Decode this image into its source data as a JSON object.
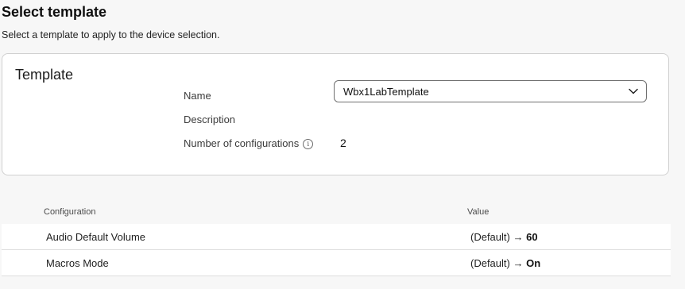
{
  "header": {
    "title": "Select template",
    "subtitle": "Select a template to apply to the device selection."
  },
  "template_card": {
    "title": "Template",
    "name_label": "Name",
    "description_label": "Description",
    "count_label": "Number of configurations",
    "count_info_icon": "info-circle-icon",
    "selected_template": "Wbx1LabTemplate",
    "dropdown_icon": "chevron-down-icon",
    "description_value": "",
    "count_value": "2"
  },
  "table": {
    "headers": [
      "Configuration",
      "Value"
    ],
    "rows": [
      {
        "configuration": "Audio Default Volume",
        "default_prefix": "(Default)",
        "arrow": "→",
        "value": "60"
      },
      {
        "configuration": "Macros Mode",
        "default_prefix": "(Default)",
        "arrow": "→",
        "value": "On"
      }
    ]
  }
}
